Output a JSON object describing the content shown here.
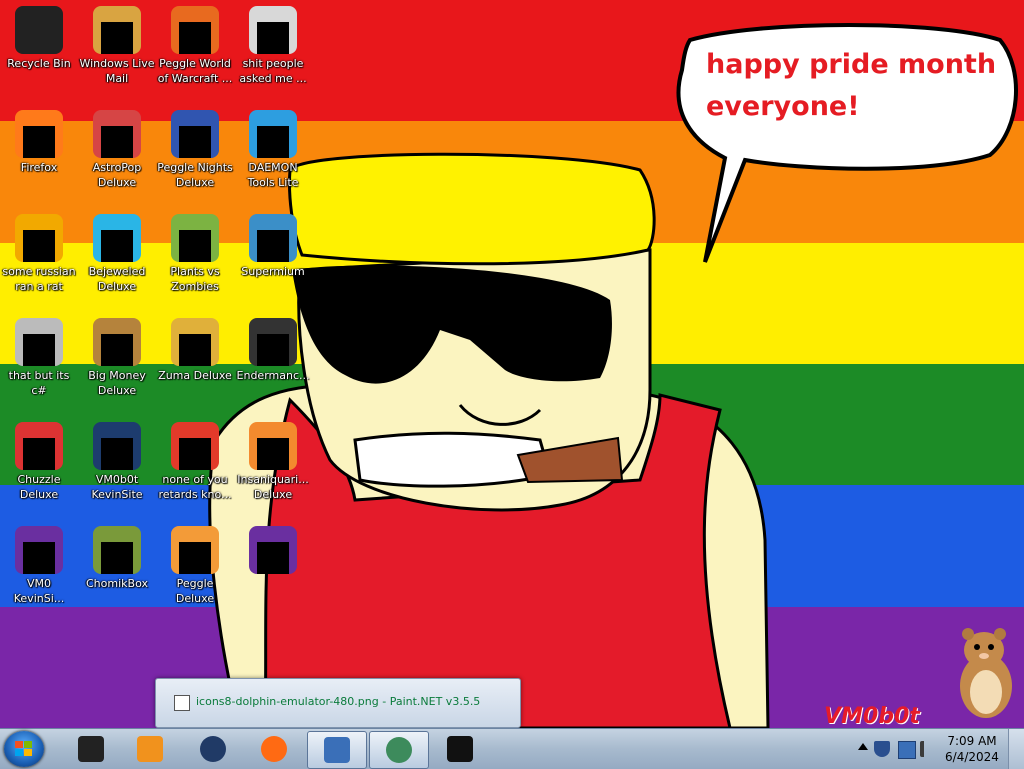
{
  "desktop": {
    "flag_colors": [
      "#e8171b",
      "#f9870b",
      "#ffee00",
      "#1c8b26",
      "#1d5ce3",
      "#7a26a8"
    ],
    "speech_bubble": {
      "line1": "happy pride month",
      "line2": "everyone!",
      "color": "#e51c23"
    },
    "watermark": "VM0b0t",
    "icons": [
      {
        "label": "Recycle Bin",
        "icon": "recycle-bin-icon"
      },
      {
        "label": "Windows Live Mail",
        "icon": "mail-icon"
      },
      {
        "label": "Peggle World of Warcraft ...",
        "icon": "peggle-icon"
      },
      {
        "label": "shit people asked me ...",
        "icon": "folder-icon"
      },
      {
        "label": "Firefox",
        "icon": "firefox-icon"
      },
      {
        "label": "AstroPop Deluxe",
        "icon": "astropop-icon"
      },
      {
        "label": "Peggle Nights Deluxe",
        "icon": "peggle-nights-icon"
      },
      {
        "label": "DAEMON Tools Lite",
        "icon": "daemon-tools-icon"
      },
      {
        "label": "some russian ran a rat",
        "icon": "document-icon"
      },
      {
        "label": "Bejeweled Deluxe",
        "icon": "bejeweled-icon"
      },
      {
        "label": "Plants vs Zombies",
        "icon": "plants-vs-zombies-icon"
      },
      {
        "label": "Supermium",
        "icon": "browser-icon"
      },
      {
        "label": "that but its c#",
        "icon": "files-icon"
      },
      {
        "label": "Big Money Deluxe",
        "icon": "money-bag-icon"
      },
      {
        "label": "Zuma Deluxe",
        "icon": "zuma-icon"
      },
      {
        "label": "Endermanc...",
        "icon": "terminal-icon"
      },
      {
        "label": "Chuzzle Deluxe",
        "icon": "chuzzle-icon"
      },
      {
        "label": "VM0b0t KevinSite",
        "icon": "app-icon"
      },
      {
        "label": "none of you retards kno...",
        "icon": "round-icon"
      },
      {
        "label": "Insaniquari... Deluxe",
        "icon": "fish-icon"
      },
      {
        "label": "VM0 KevinSi...",
        "icon": "visual-studio-icon"
      },
      {
        "label": "ChomikBox",
        "icon": "chomikbox-icon"
      },
      {
        "label": "Peggle Deluxe",
        "icon": "peggle-deluxe-icon"
      },
      {
        "label": "",
        "icon": "visual-studio-icon"
      }
    ]
  },
  "thumbnail": {
    "title": "icons8-dolphin-emulator-480.png - Paint.NET v3.5.5"
  },
  "taskbar": {
    "items": [
      {
        "icon": "dark-box-icon",
        "active": false
      },
      {
        "icon": "media-player-icon",
        "active": false
      },
      {
        "icon": "globe-icon",
        "active": false
      },
      {
        "icon": "firefox-icon",
        "active": false
      },
      {
        "icon": "paint-net-icon",
        "active": true
      },
      {
        "icon": "browser-icon",
        "active": true
      },
      {
        "icon": "terminal-icon",
        "active": false
      }
    ],
    "clock": {
      "time": "7:09 AM",
      "date": "6/4/2024"
    }
  }
}
